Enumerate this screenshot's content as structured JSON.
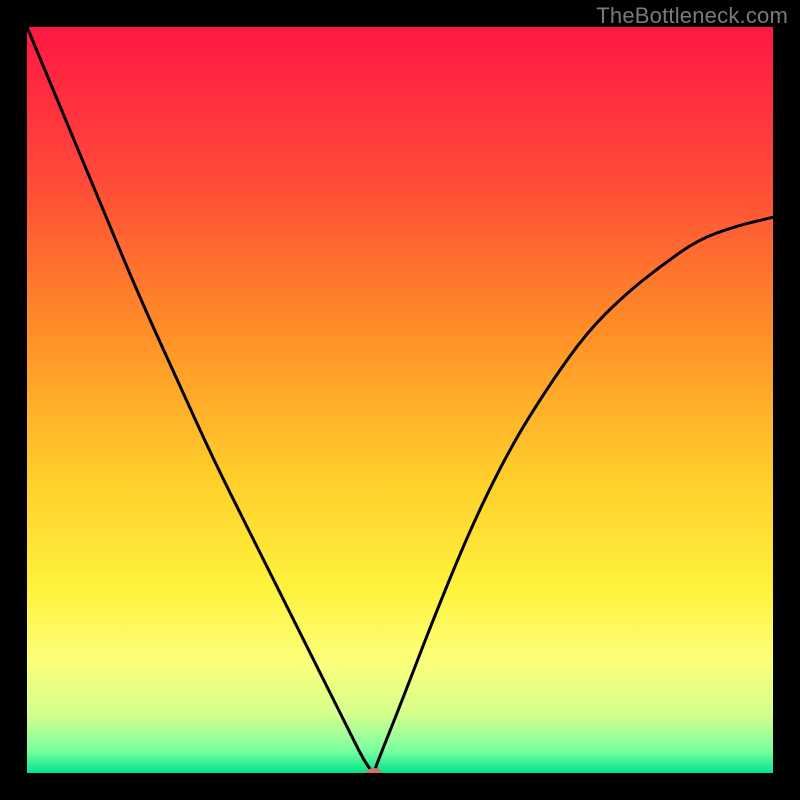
{
  "branding": {
    "watermark": "TheBottleneck.com"
  },
  "chart_data": {
    "type": "line",
    "title": "",
    "xlabel": "",
    "ylabel": "",
    "xlim": [
      0,
      100
    ],
    "ylim": [
      0,
      100
    ],
    "grid": false,
    "legend": false,
    "background_gradient": {
      "type": "vertical",
      "stops": [
        {
          "pos": 0.0,
          "color": "#ff1744"
        },
        {
          "pos": 0.2,
          "color": "#ff4939"
        },
        {
          "pos": 0.4,
          "color": "#ff8c28"
        },
        {
          "pos": 0.6,
          "color": "#ffcd2a"
        },
        {
          "pos": 0.75,
          "color": "#fff23c"
        },
        {
          "pos": 0.85,
          "color": "#fcff7a"
        },
        {
          "pos": 0.92,
          "color": "#d6ff8c"
        },
        {
          "pos": 0.97,
          "color": "#7affa0"
        },
        {
          "pos": 1.0,
          "color": "#00e58b"
        }
      ]
    },
    "series": [
      {
        "name": "bottleneck-curve",
        "color": "#000000",
        "x": [
          0,
          5,
          10,
          15,
          20,
          25,
          30,
          35,
          40,
          43,
          45,
          46,
          46.5,
          47,
          50,
          55,
          60,
          65,
          70,
          75,
          80,
          85,
          90,
          95,
          100
        ],
        "y": [
          100,
          88,
          76,
          64,
          53,
          42,
          32,
          22,
          12,
          6,
          2,
          0.5,
          0,
          1.5,
          9,
          22,
          34,
          44,
          52,
          59,
          64,
          68,
          71.5,
          73.3,
          74.5
        ]
      }
    ],
    "marker": {
      "name": "optimal-point",
      "x": 46.5,
      "y": 0,
      "color": "#c9766b",
      "rx": 8,
      "ry": 5
    }
  }
}
